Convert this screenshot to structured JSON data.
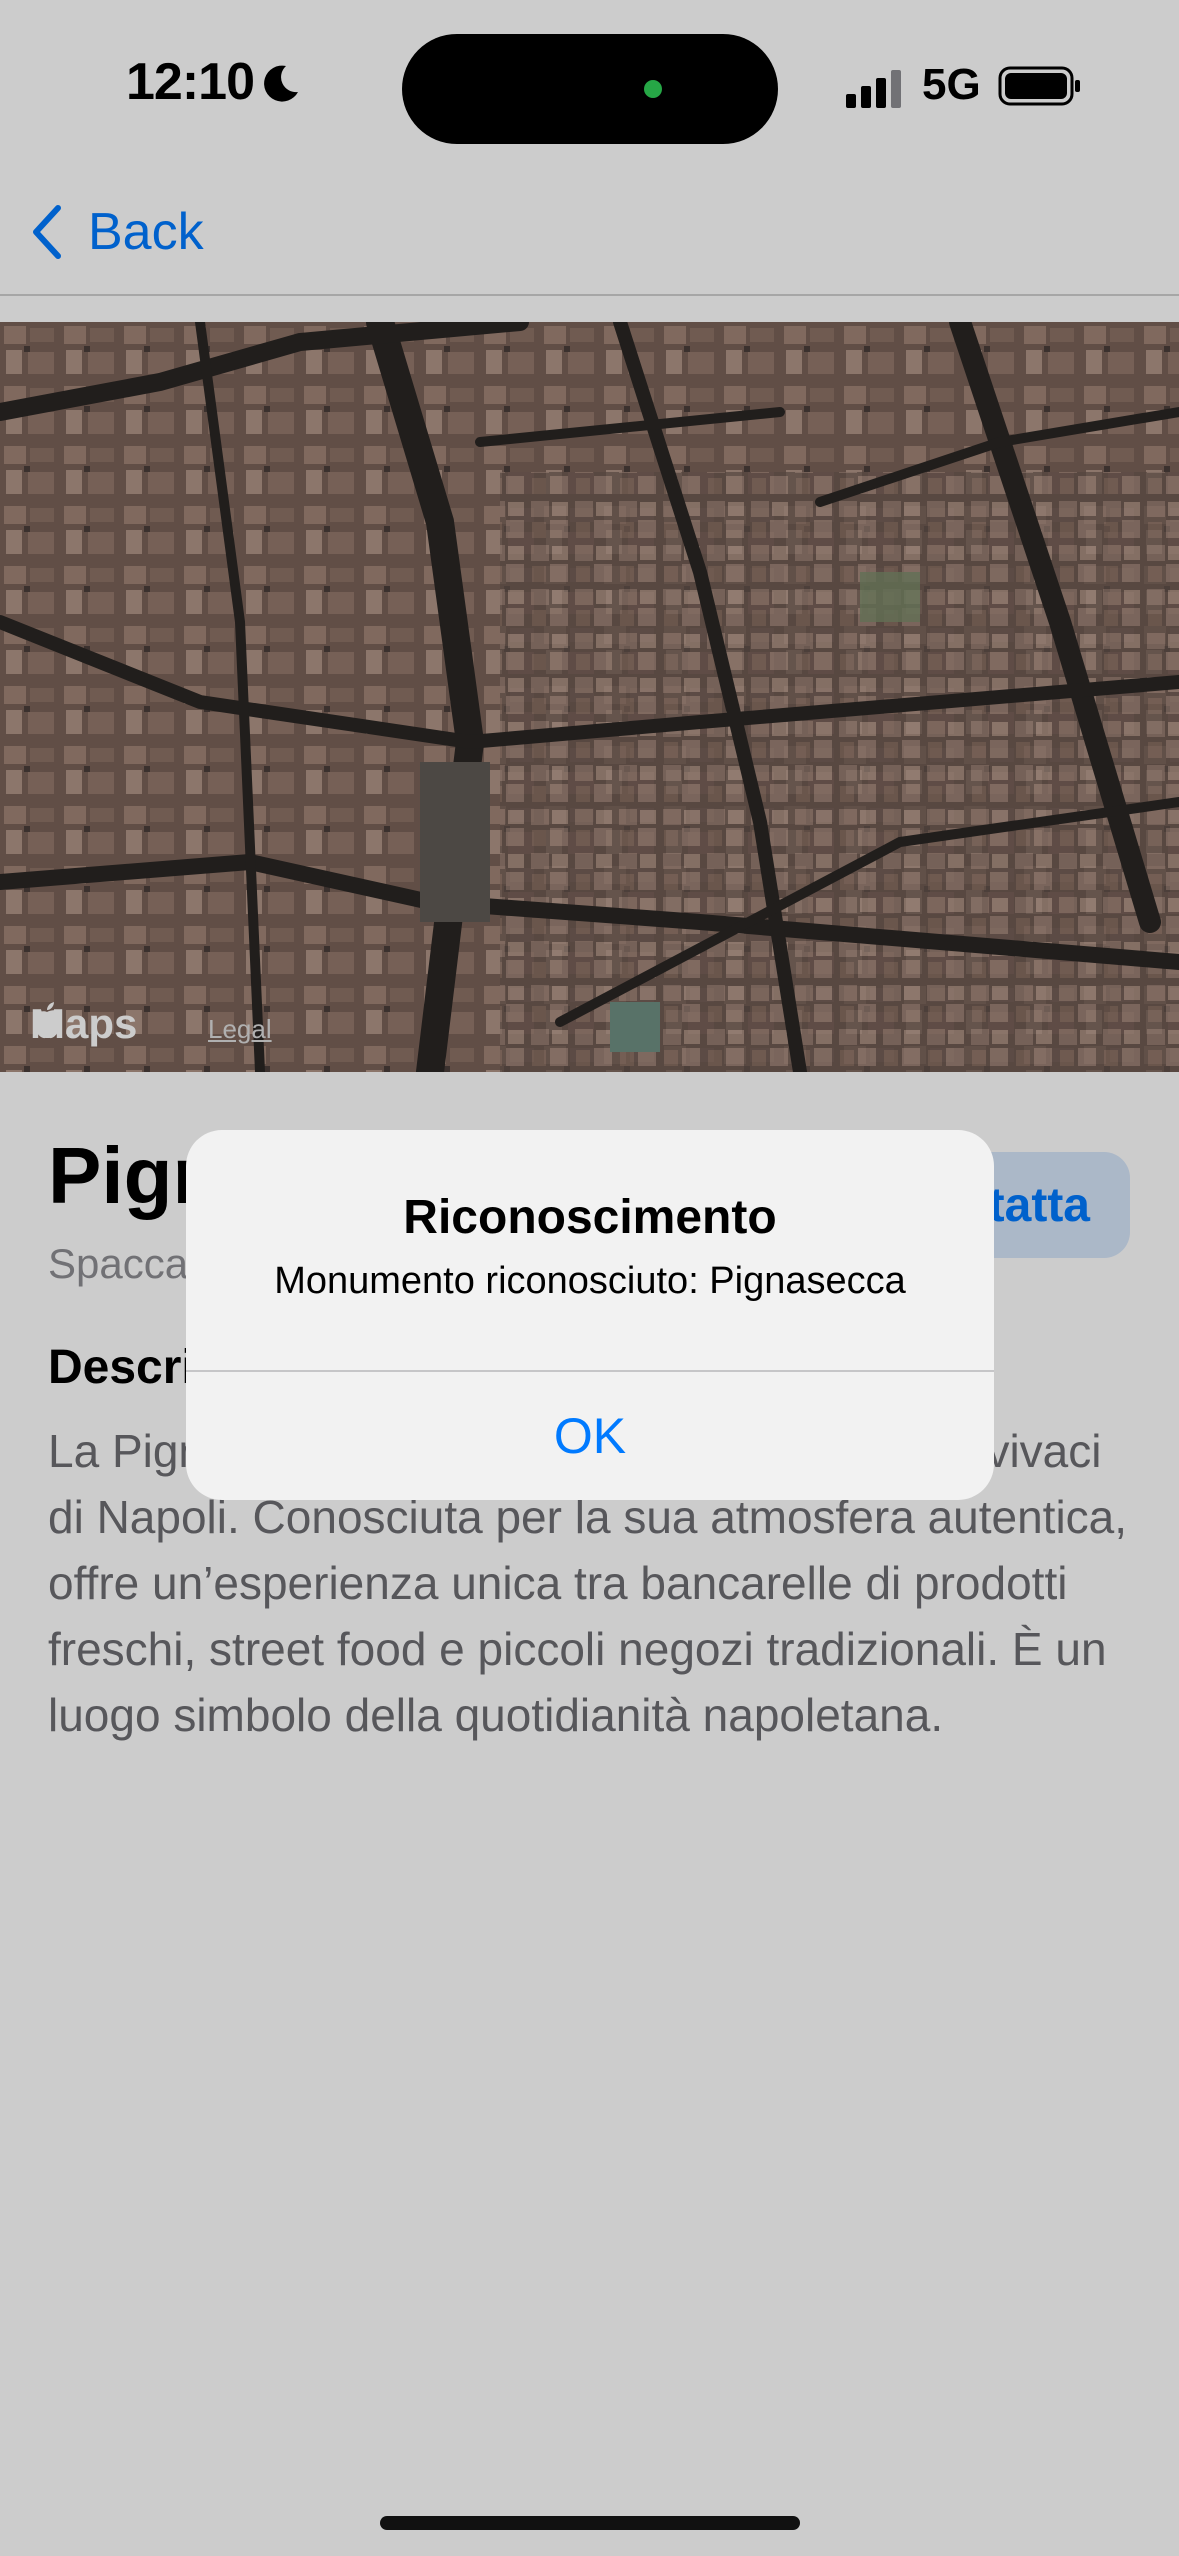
{
  "status_bar": {
    "time": "12:10",
    "network": "5G"
  },
  "nav": {
    "back_label": "Back"
  },
  "map": {
    "logo_text": "Maps",
    "legal_label": "Legal"
  },
  "place": {
    "title": "Pignasecca",
    "subtitle": "Spaccanapoli",
    "action_label": "Contatta",
    "section_heading": "Descrizione",
    "description": "La Pignasecca è uno dei mercati più antichi e vivaci di Napoli. Conosciuta per la sua atmosfera autentica, offre un’esperienza unica tra bancarelle di prodotti freschi, street food e piccoli negozi tradizionali. È un luogo simbolo della quotidianità napoletana."
  },
  "alert": {
    "title": "Riconoscimento",
    "message": "Monumento riconosciuto: Pignasecca",
    "ok_label": "OK"
  },
  "colors": {
    "accent": "#007aff",
    "status_dot": "#30d158"
  }
}
